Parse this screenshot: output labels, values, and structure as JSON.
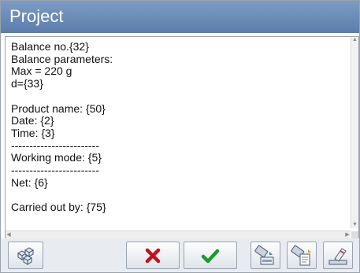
{
  "window": {
    "title": "Project"
  },
  "editor": {
    "lines": [
      "Balance no.{32}",
      "Balance parameters:",
      "Max = 220 g",
      "d={33}",
      "",
      "Product name: {50}",
      "Date: {2}",
      "Time: {3}",
      "------------------------",
      "Working mode: {5}",
      "------------------------",
      "Net: {6}",
      "",
      "Carried out by: {75}"
    ]
  },
  "toolbar": {
    "buttons": [
      {
        "name": "variables-button",
        "icon": "cubes-icon"
      },
      {
        "name": "cancel-button",
        "icon": "red-x-icon",
        "color": "#c0141a"
      },
      {
        "name": "confirm-button",
        "icon": "green-check-icon",
        "color": "#1a9a2a"
      },
      {
        "name": "load-from-usb-button",
        "icon": "usb-load-icon"
      },
      {
        "name": "save-to-usb-button",
        "icon": "usb-save-icon"
      },
      {
        "name": "clear-button",
        "icon": "eraser-icon"
      }
    ]
  }
}
